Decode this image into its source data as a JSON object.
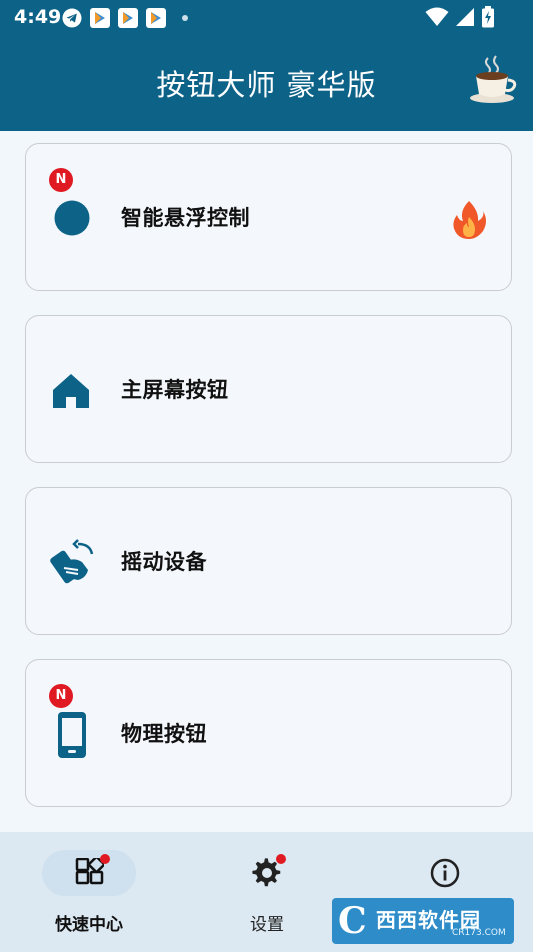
{
  "status_bar": {
    "time": "4:49",
    "icons": [
      "telegram-icon",
      "play-store-icon",
      "play-store-icon",
      "play-store-icon",
      "notification-dot-icon"
    ],
    "right_icons": [
      "wifi-icon",
      "signal-icon",
      "battery-charging-icon"
    ]
  },
  "app_bar": {
    "title": "按钮大师 豪华版",
    "action_icon": "coffee-cup-icon",
    "color": "#0d6288"
  },
  "cards": [
    {
      "label": "智能悬浮控制",
      "icon": "floating-circle-icon",
      "badge": "N",
      "trailing_icon": "fire-icon"
    },
    {
      "label": "主屏幕按钮",
      "icon": "home-icon"
    },
    {
      "label": "摇动设备",
      "icon": "shake-device-icon"
    },
    {
      "label": "物理按钮",
      "icon": "phone-device-icon",
      "badge": "N"
    }
  ],
  "bottom_nav": {
    "items": [
      {
        "label": "快速中心",
        "icon": "dashboard-grid-icon",
        "active": true,
        "dot": true
      },
      {
        "label": "设置",
        "icon": "gear-icon",
        "active": false,
        "dot": true
      },
      {
        "label": "",
        "icon": "info-icon",
        "active": false,
        "dot": false
      }
    ]
  },
  "watermark": {
    "text": "西西软件园",
    "sub": "CR173.COM"
  },
  "colors": {
    "accent": "#0d6288",
    "badge": "#e01a22",
    "background": "#f2f7fb"
  }
}
